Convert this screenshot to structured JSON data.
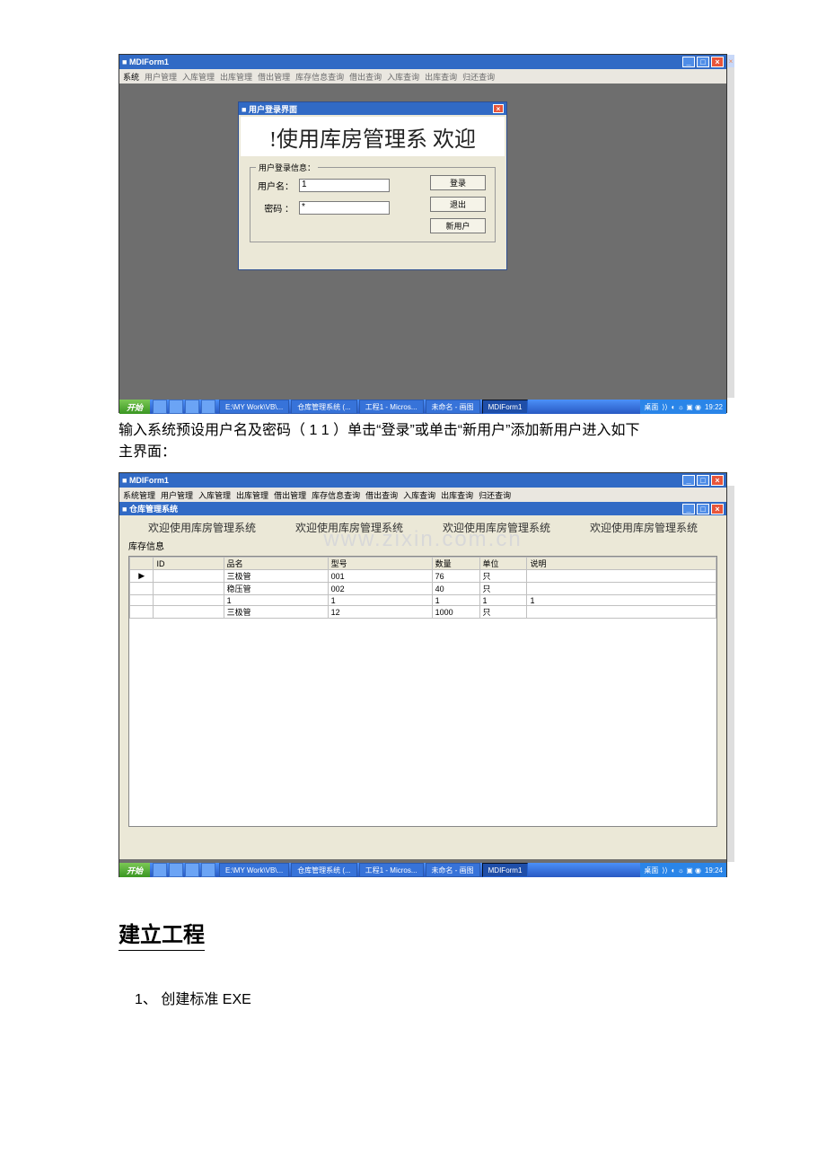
{
  "screenshot1": {
    "window_title": "MDIForm1",
    "menu": [
      "系统",
      "用户管理",
      "入库管理",
      "出库管理",
      "借出管理",
      "库存信息查询",
      "借出查询",
      "入库查询",
      "出库查询",
      "归还查询"
    ],
    "login_dialog": {
      "title": "用户登录界面",
      "banner": "!使用库房管理系   欢迎",
      "fieldset_legend": "用户登录信息：",
      "username_label": "用户名：",
      "username_value": "1",
      "password_label": "密码 ：",
      "password_value": "*",
      "btn_login": "登录",
      "btn_exit": "退出",
      "btn_newuser": "新用户"
    },
    "taskbar": {
      "start": "开始",
      "items": [
        "E:\\MY Work\\VB\\...",
        "仓库管理系统 (...",
        "工程1 - Micros...",
        "未命名 - 画图",
        "MDIForm1"
      ],
      "tray_left": "桌面",
      "time": "19:22"
    }
  },
  "doc_para1": "输入系统预设用户名及密码（ 1   1 ）单击“登录”或单击“新用户”添加新用户进入如下",
  "doc_para2": "主界面：",
  "screenshot2": {
    "window_title": "MDIForm1",
    "menu": [
      "系统管理",
      "用户管理",
      "入库管理",
      "出库管理",
      "借出管理",
      "库存信息查询",
      "借出查询",
      "入库查询",
      "出库查询",
      "归还查询"
    ],
    "child_title": "仓库管理系统",
    "marquee": "欢迎使用库房管理系统",
    "watermark": "www.zixin.com.cn",
    "grid_label": "库存信息",
    "columns": [
      "ID",
      "品名",
      "型号",
      "数量",
      "单位",
      "说明"
    ],
    "rows": [
      [
        "",
        "三极管",
        "001",
        "76",
        "只",
        ""
      ],
      [
        "",
        "稳压管",
        "002",
        "40",
        "只",
        ""
      ],
      [
        "",
        "1",
        "1",
        "1",
        "1",
        "1"
      ],
      [
        "",
        "三极管",
        "12",
        "1000",
        "只",
        ""
      ]
    ],
    "taskbar": {
      "start": "开始",
      "items": [
        "E:\\MY Work\\VB\\...",
        "仓库管理系统 (...",
        "工程1 - Micros...",
        "未命名 - 画图",
        "MDIForm1"
      ],
      "tray_left": "桌面",
      "time": "19:24"
    }
  },
  "heading2": "建立工程",
  "list1": "1、 创建标准 EXE"
}
